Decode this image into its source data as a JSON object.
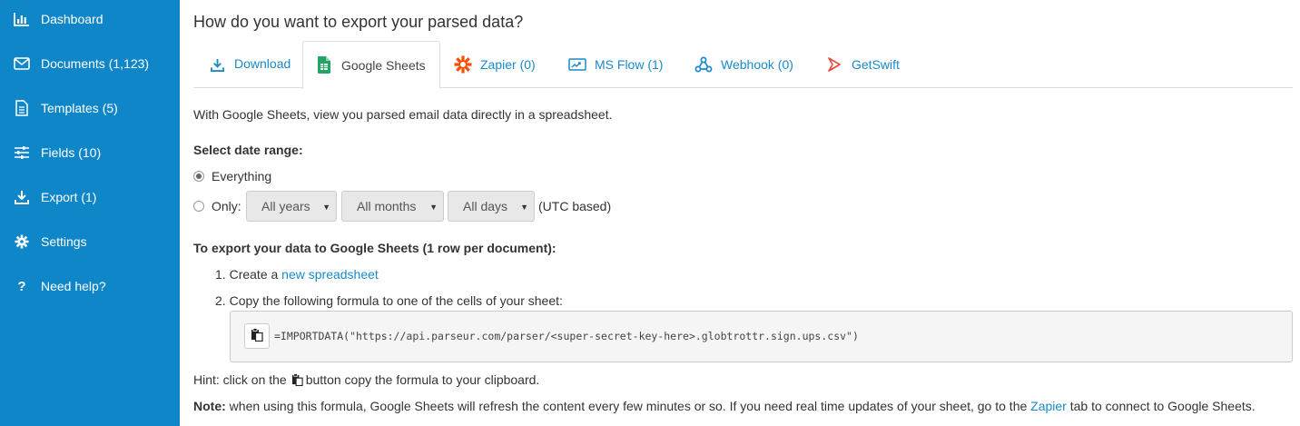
{
  "sidebar": {
    "items": [
      {
        "label": "Dashboard",
        "icon": "bar-chart-icon"
      },
      {
        "label": "Documents (1,123)",
        "icon": "envelope-icon"
      },
      {
        "label": "Templates (5)",
        "icon": "document-icon"
      },
      {
        "label": "Fields (10)",
        "icon": "sliders-icon"
      },
      {
        "label": "Export (1)",
        "icon": "download-icon"
      },
      {
        "label": "Settings",
        "icon": "gear-icon"
      },
      {
        "label": "Need help?",
        "icon": "question-icon"
      }
    ]
  },
  "main": {
    "heading": "How do you want to export your parsed data?",
    "tabs": [
      {
        "label": "Download",
        "icon": "download-icon",
        "active": false
      },
      {
        "label": "Google Sheets",
        "icon": "google-sheets-icon",
        "active": true
      },
      {
        "label": "Zapier (0)",
        "icon": "zapier-icon",
        "active": false
      },
      {
        "label": "MS Flow (1)",
        "icon": "ms-flow-icon",
        "active": false
      },
      {
        "label": "Webhook (0)",
        "icon": "webhook-icon",
        "active": false
      },
      {
        "label": "GetSwift",
        "icon": "getswift-icon",
        "active": false
      }
    ],
    "intro": "With Google Sheets, view you parsed email data directly in a spreadsheet.",
    "date_range": {
      "label": "Select date range:",
      "option_everything": "Everything",
      "option_only": "Only:",
      "years": "All years",
      "months": "All months",
      "days": "All days",
      "utc_note": "(UTC based)"
    },
    "export_section": {
      "label": "To export your data to Google Sheets (1 row per document):",
      "step1_num": "1.",
      "step1_text": "Create a",
      "step1_link": "new spreadsheet",
      "step2_num": "2.",
      "step2_text": "Copy the following formula to one of the cells of your sheet:",
      "formula": "=IMPORTDATA(\"https://api.parseur.com/parser/<super-secret-key-here>.globtrottr.sign.ups.csv\")"
    },
    "hint_before": "Hint: click on the",
    "hint_after": "button copy the formula to your clipboard.",
    "note_label": "Note:",
    "note_text": "when using this formula, Google Sheets will refresh the content every few minutes or so. If you need real time updates of your sheet, go to the",
    "note_link": "Zapier",
    "note_after": "tab to connect to Google Sheets."
  },
  "colors": {
    "sidebar": "#0f86c8",
    "link": "#1a8ac9",
    "sheets_green": "#23a566",
    "zapier_orange": "#ff4a00",
    "getswift_red": "#e8483b"
  }
}
